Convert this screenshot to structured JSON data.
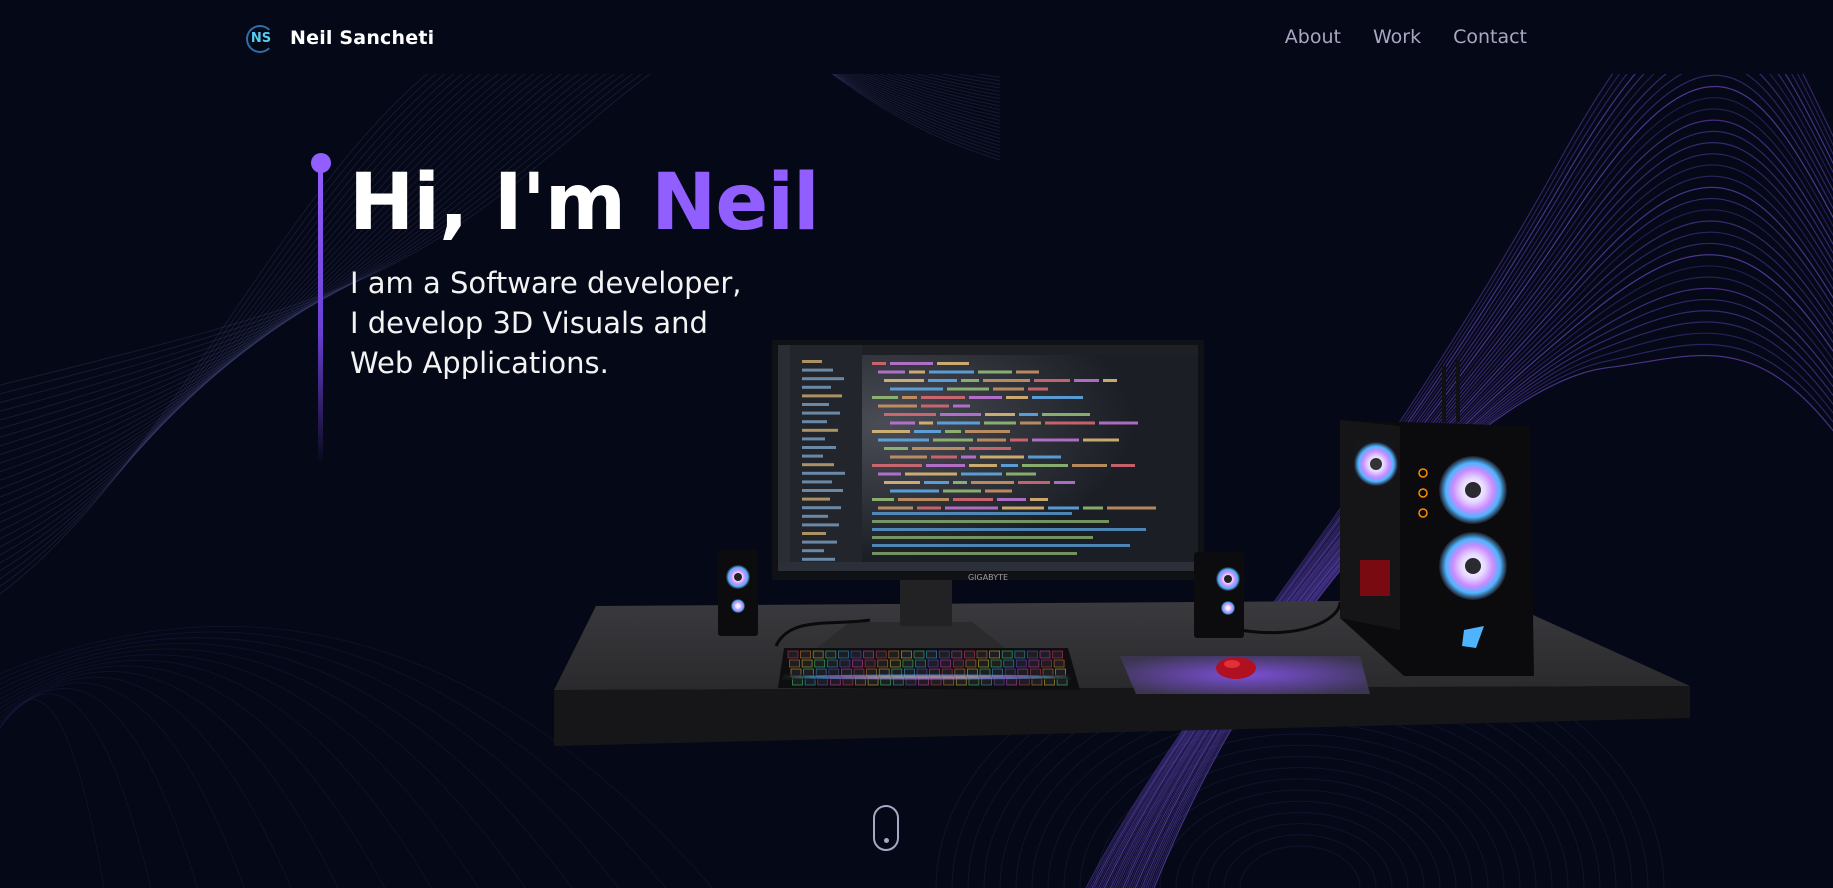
{
  "nav": {
    "logo_text": "NS",
    "brand_name": "Neil Sancheti",
    "links": [
      "About",
      "Work",
      "Contact"
    ]
  },
  "hero": {
    "greeting": "Hi, I'm ",
    "name": "Neil",
    "subtitle_lines": [
      "I am a Software developer,",
      "I develop 3D Visuals and",
      "Web Applications."
    ]
  },
  "scene": {
    "monitor_brand": "GIGABYTE"
  },
  "colors": {
    "background": "#050816",
    "accent": "#915eff",
    "nav_text": "#aaa6c3",
    "logo": "#56ccf2"
  },
  "icons": {
    "scroll": "scroll-mouse-icon"
  }
}
